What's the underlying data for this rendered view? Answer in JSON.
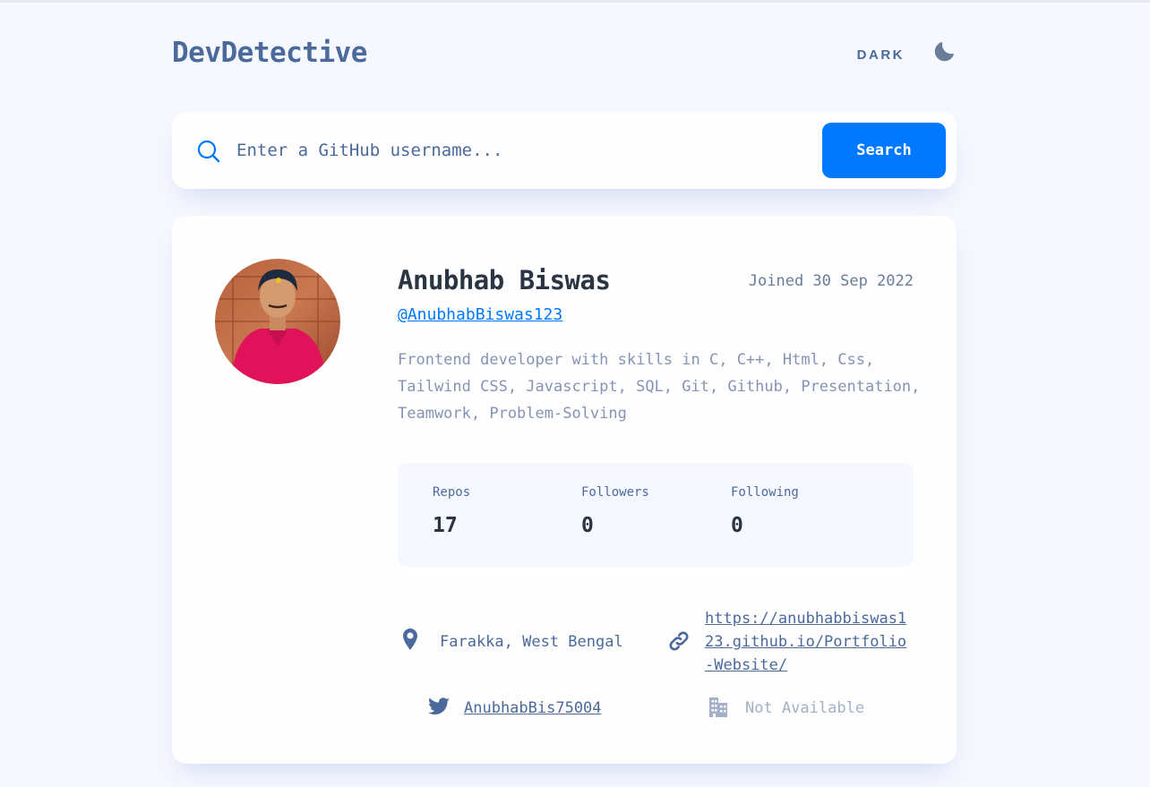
{
  "app": {
    "title": "DevDetective",
    "theme_label": "DARK"
  },
  "search": {
    "placeholder": "Enter a GitHub username...",
    "value": "",
    "button_label": "Search"
  },
  "profile": {
    "name": "Anubhab Biswas",
    "joined": "Joined 30 Sep 2022",
    "handle": "@AnubhabBiswas123",
    "bio": "Frontend developer with skills in C, C++, Html, Css, Tailwind CSS, Javascript, SQL, Git, Github, Presentation, Teamwork, Problem-Solving",
    "stats": [
      {
        "label": "Repos",
        "value": "17"
      },
      {
        "label": "Followers",
        "value": "0"
      },
      {
        "label": "Following",
        "value": "0"
      }
    ],
    "links": {
      "location": "Farakka, West Bengal",
      "blog": "https://anubhabbiswas123.github.io/Portfolio-Website/",
      "twitter": "AnubhabBis75004",
      "company": "Not Available"
    }
  },
  "colors": {
    "accent": "#0079ff",
    "background": "#f6f8ff",
    "card": "#fefefe",
    "text_primary": "#2b3442",
    "text_secondary": "#4b6a9b",
    "muted": "#a3b0c8"
  },
  "icons": [
    "moon-icon",
    "search-icon",
    "location-icon",
    "link-icon",
    "twitter-icon",
    "company-icon"
  ]
}
